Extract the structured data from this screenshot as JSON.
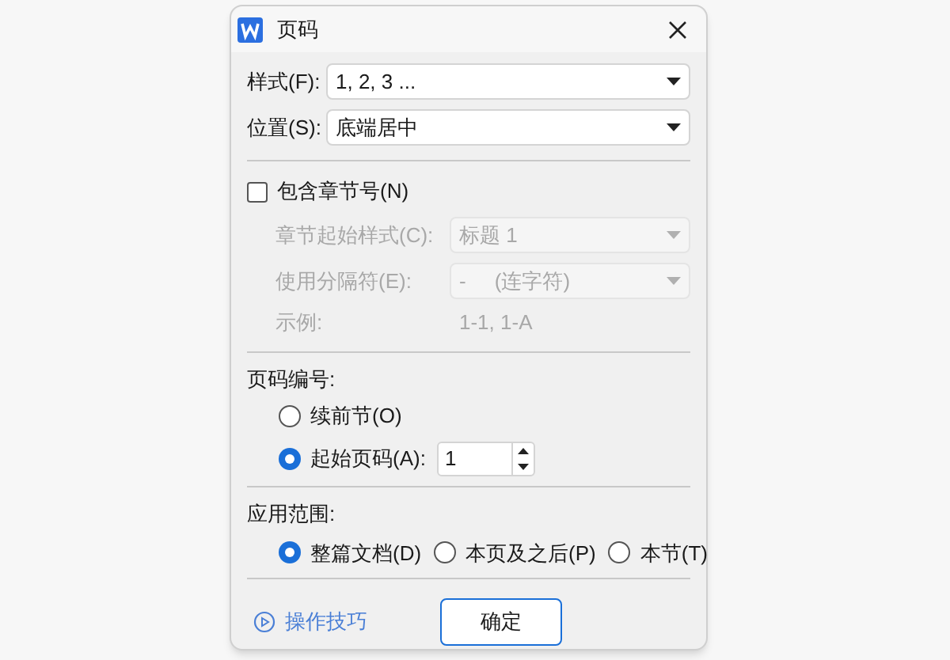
{
  "window": {
    "title": "页码"
  },
  "style_field": {
    "label": "样式(F):",
    "value": "1, 2, 3 ..."
  },
  "position_field": {
    "label": "位置(S):",
    "value": "底端居中"
  },
  "include_chapter": {
    "label": "包含章节号(N)",
    "checked": false
  },
  "chapter_fields": [
    {
      "label": "章节起始样式(C):",
      "value": "标题 1",
      "disabled": true
    },
    {
      "label": "使用分隔符(E):",
      "value": "-     (连字符)",
      "disabled": true
    }
  ],
  "example": {
    "label": "示例:",
    "value": "1-1, 1-A",
    "disabled": true
  },
  "numbering": {
    "heading": "页码编号:",
    "options": [
      {
        "label": "续前节(O)",
        "selected": false
      },
      {
        "label": "起始页码(A):",
        "selected": true
      }
    ],
    "start_value": "1"
  },
  "scope": {
    "heading": "应用范围:",
    "options": [
      {
        "label": "整篇文档(D)",
        "selected": true
      },
      {
        "label": "本页及之后(P)",
        "selected": false
      },
      {
        "label": "本节(T)",
        "selected": false
      }
    ]
  },
  "tips_link": "操作技巧",
  "buttons": [
    "确定"
  ]
}
